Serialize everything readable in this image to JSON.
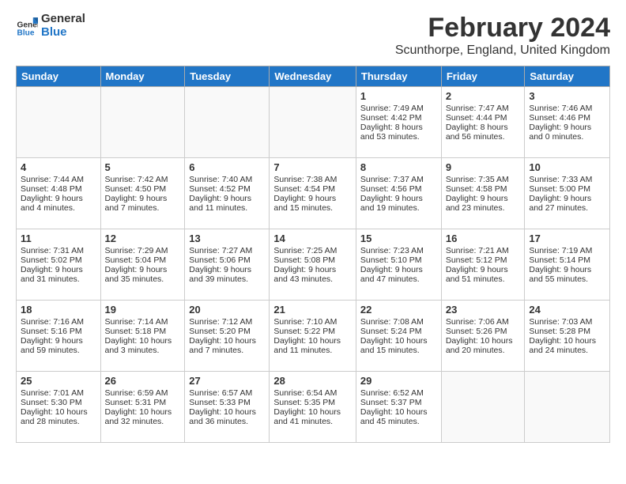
{
  "header": {
    "logo_line1": "General",
    "logo_line2": "Blue",
    "main_title": "February 2024",
    "sub_title": "Scunthorpe, England, United Kingdom"
  },
  "weekdays": [
    "Sunday",
    "Monday",
    "Tuesday",
    "Wednesday",
    "Thursday",
    "Friday",
    "Saturday"
  ],
  "weeks": [
    [
      {
        "day": "",
        "info": ""
      },
      {
        "day": "",
        "info": ""
      },
      {
        "day": "",
        "info": ""
      },
      {
        "day": "",
        "info": ""
      },
      {
        "day": "1",
        "info": "Sunrise: 7:49 AM\nSunset: 4:42 PM\nDaylight: 8 hours\nand 53 minutes."
      },
      {
        "day": "2",
        "info": "Sunrise: 7:47 AM\nSunset: 4:44 PM\nDaylight: 8 hours\nand 56 minutes."
      },
      {
        "day": "3",
        "info": "Sunrise: 7:46 AM\nSunset: 4:46 PM\nDaylight: 9 hours\nand 0 minutes."
      }
    ],
    [
      {
        "day": "4",
        "info": "Sunrise: 7:44 AM\nSunset: 4:48 PM\nDaylight: 9 hours\nand 4 minutes."
      },
      {
        "day": "5",
        "info": "Sunrise: 7:42 AM\nSunset: 4:50 PM\nDaylight: 9 hours\nand 7 minutes."
      },
      {
        "day": "6",
        "info": "Sunrise: 7:40 AM\nSunset: 4:52 PM\nDaylight: 9 hours\nand 11 minutes."
      },
      {
        "day": "7",
        "info": "Sunrise: 7:38 AM\nSunset: 4:54 PM\nDaylight: 9 hours\nand 15 minutes."
      },
      {
        "day": "8",
        "info": "Sunrise: 7:37 AM\nSunset: 4:56 PM\nDaylight: 9 hours\nand 19 minutes."
      },
      {
        "day": "9",
        "info": "Sunrise: 7:35 AM\nSunset: 4:58 PM\nDaylight: 9 hours\nand 23 minutes."
      },
      {
        "day": "10",
        "info": "Sunrise: 7:33 AM\nSunset: 5:00 PM\nDaylight: 9 hours\nand 27 minutes."
      }
    ],
    [
      {
        "day": "11",
        "info": "Sunrise: 7:31 AM\nSunset: 5:02 PM\nDaylight: 9 hours\nand 31 minutes."
      },
      {
        "day": "12",
        "info": "Sunrise: 7:29 AM\nSunset: 5:04 PM\nDaylight: 9 hours\nand 35 minutes."
      },
      {
        "day": "13",
        "info": "Sunrise: 7:27 AM\nSunset: 5:06 PM\nDaylight: 9 hours\nand 39 minutes."
      },
      {
        "day": "14",
        "info": "Sunrise: 7:25 AM\nSunset: 5:08 PM\nDaylight: 9 hours\nand 43 minutes."
      },
      {
        "day": "15",
        "info": "Sunrise: 7:23 AM\nSunset: 5:10 PM\nDaylight: 9 hours\nand 47 minutes."
      },
      {
        "day": "16",
        "info": "Sunrise: 7:21 AM\nSunset: 5:12 PM\nDaylight: 9 hours\nand 51 minutes."
      },
      {
        "day": "17",
        "info": "Sunrise: 7:19 AM\nSunset: 5:14 PM\nDaylight: 9 hours\nand 55 minutes."
      }
    ],
    [
      {
        "day": "18",
        "info": "Sunrise: 7:16 AM\nSunset: 5:16 PM\nDaylight: 9 hours\nand 59 minutes."
      },
      {
        "day": "19",
        "info": "Sunrise: 7:14 AM\nSunset: 5:18 PM\nDaylight: 10 hours\nand 3 minutes."
      },
      {
        "day": "20",
        "info": "Sunrise: 7:12 AM\nSunset: 5:20 PM\nDaylight: 10 hours\nand 7 minutes."
      },
      {
        "day": "21",
        "info": "Sunrise: 7:10 AM\nSunset: 5:22 PM\nDaylight: 10 hours\nand 11 minutes."
      },
      {
        "day": "22",
        "info": "Sunrise: 7:08 AM\nSunset: 5:24 PM\nDaylight: 10 hours\nand 15 minutes."
      },
      {
        "day": "23",
        "info": "Sunrise: 7:06 AM\nSunset: 5:26 PM\nDaylight: 10 hours\nand 20 minutes."
      },
      {
        "day": "24",
        "info": "Sunrise: 7:03 AM\nSunset: 5:28 PM\nDaylight: 10 hours\nand 24 minutes."
      }
    ],
    [
      {
        "day": "25",
        "info": "Sunrise: 7:01 AM\nSunset: 5:30 PM\nDaylight: 10 hours\nand 28 minutes."
      },
      {
        "day": "26",
        "info": "Sunrise: 6:59 AM\nSunset: 5:31 PM\nDaylight: 10 hours\nand 32 minutes."
      },
      {
        "day": "27",
        "info": "Sunrise: 6:57 AM\nSunset: 5:33 PM\nDaylight: 10 hours\nand 36 minutes."
      },
      {
        "day": "28",
        "info": "Sunrise: 6:54 AM\nSunset: 5:35 PM\nDaylight: 10 hours\nand 41 minutes."
      },
      {
        "day": "29",
        "info": "Sunrise: 6:52 AM\nSunset: 5:37 PM\nDaylight: 10 hours\nand 45 minutes."
      },
      {
        "day": "",
        "info": ""
      },
      {
        "day": "",
        "info": ""
      }
    ]
  ]
}
